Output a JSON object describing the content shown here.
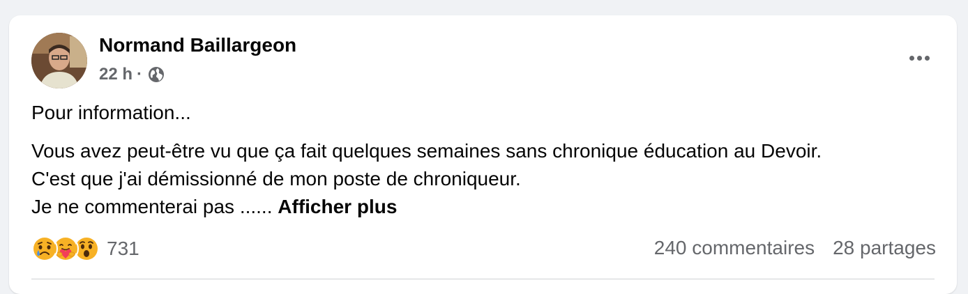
{
  "post": {
    "author": "Normand Baillargeon",
    "time": "22 h",
    "separator": "·",
    "privacy_icon": "globe-icon",
    "more_icon": "ellipsis-icon",
    "paragraph1": "Pour information...",
    "paragraph2_line1": "Vous avez peut-être vu que ça fait quelques semaines sans chronique éducation au Devoir.",
    "paragraph2_line2": "C'est que j'ai démissionné de mon poste de chroniqueur.",
    "paragraph2_line3": "Je ne commenterai pas ......",
    "see_more": "Afficher plus"
  },
  "reactions": {
    "icons": [
      "sad-icon",
      "care-icon",
      "wow-icon"
    ],
    "count": "731"
  },
  "stats": {
    "comments": "240 commentaires",
    "shares": "28 partages"
  },
  "colors": {
    "secondary_text": "#65676b",
    "primary_text": "#050505",
    "reaction_yellow": "#f7b125"
  }
}
